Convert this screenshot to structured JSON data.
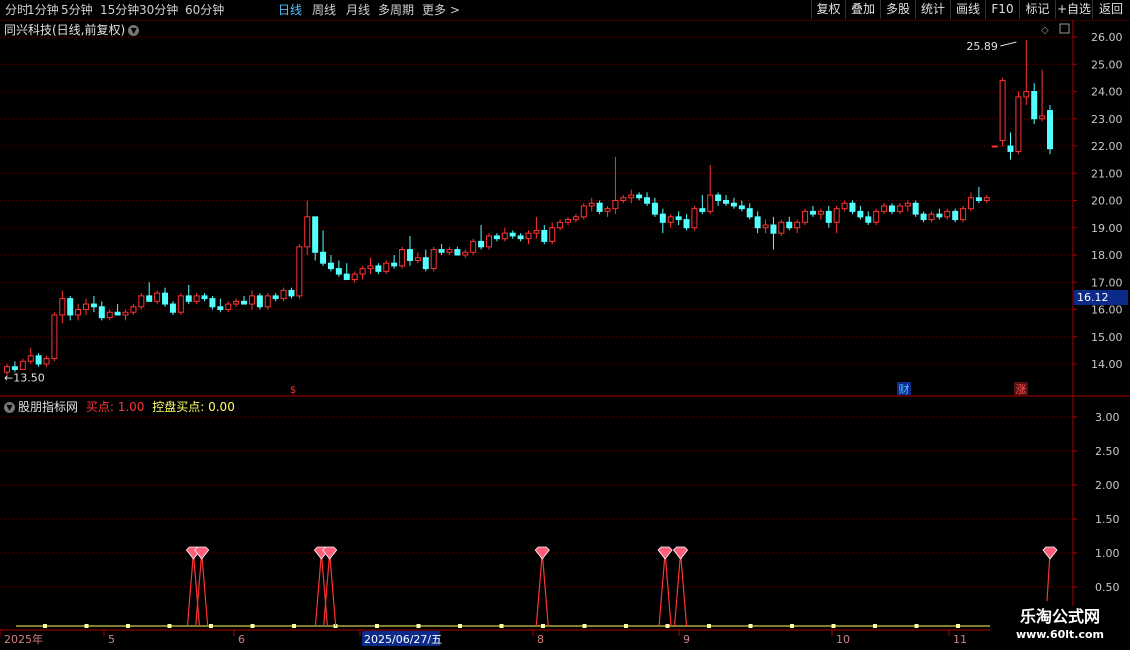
{
  "toolbar": {
    "periods": [
      {
        "label": "分时",
        "active": false
      },
      {
        "label": "1分钟",
        "active": false
      },
      {
        "label": "5分钟",
        "active": false
      },
      {
        "label": "15分钟",
        "active": false
      },
      {
        "label": "30分钟",
        "active": false
      },
      {
        "label": "60分钟",
        "active": false
      },
      {
        "label": "日线",
        "active": true
      },
      {
        "label": "周线",
        "active": false
      },
      {
        "label": "月线",
        "active": false
      },
      {
        "label": "多周期",
        "active": false
      },
      {
        "label": "更多 >",
        "active": false
      }
    ],
    "right": [
      "复权",
      "叠加",
      "多股",
      "统计",
      "画线",
      "F10",
      "标记",
      "+自选",
      "返回"
    ]
  },
  "main_chart": {
    "title": "同兴科技(日线,前复权)",
    "dropdown_icon": "chevron-down-icon",
    "y_ticks": [
      "26.00",
      "25.00",
      "24.00",
      "23.00",
      "22.00",
      "21.00",
      "20.00",
      "19.00",
      "18.00",
      "17.00",
      "16.00",
      "15.00",
      "14.00"
    ],
    "current_price": "16.12",
    "high_label": "25.89",
    "low_label": "13.50",
    "event_markers": [
      {
        "text": "$",
        "color": "#ff3333"
      },
      {
        "text": "财",
        "color": "#4fc3ff"
      },
      {
        "text": "涨",
        "color": "#ff5555"
      }
    ]
  },
  "indicator": {
    "name": "股朋指标网",
    "items": [
      {
        "label": "买点: 1.00",
        "color": "#ff3333"
      },
      {
        "label": "控盘买点: 0.00",
        "color": "#ffff66"
      }
    ],
    "y_ticks": [
      "3.00",
      "2.50",
      "2.00",
      "1.50",
      "1.00",
      "0.50"
    ]
  },
  "date_axis": {
    "labels": [
      "2025年",
      "5",
      "6",
      "2025/06/27/五",
      "8",
      "9",
      "10",
      "11"
    ]
  },
  "watermark": {
    "line1": "乐淘公式网",
    "line2": "www.60lt.com"
  },
  "colors": {
    "up": "#ff3333",
    "down": "#54ffff",
    "grid": "#6b0000",
    "indicator_line": "#ff3333",
    "baseline": "#ffff66"
  },
  "chart_data": [
    {
      "type": "candlestick",
      "title": "同兴科技(日线,前复权)",
      "ylim": [
        13.5,
        26.3
      ],
      "y_ticks": [
        14,
        15,
        16,
        17,
        18,
        19,
        20,
        21,
        22,
        23,
        24,
        25,
        26
      ],
      "candles": [
        {
          "o": 13.7,
          "h": 14.0,
          "l": 13.5,
          "c": 13.9
        },
        {
          "o": 13.9,
          "h": 14.1,
          "l": 13.7,
          "c": 13.8
        },
        {
          "o": 13.8,
          "h": 14.2,
          "l": 13.8,
          "c": 14.1
        },
        {
          "o": 14.1,
          "h": 14.6,
          "l": 14.0,
          "c": 14.3
        },
        {
          "o": 14.3,
          "h": 14.4,
          "l": 13.9,
          "c": 14.0
        },
        {
          "o": 14.0,
          "h": 14.3,
          "l": 13.9,
          "c": 14.2
        },
        {
          "o": 14.2,
          "h": 15.9,
          "l": 14.1,
          "c": 15.8
        },
        {
          "o": 15.8,
          "h": 16.7,
          "l": 15.5,
          "c": 16.4
        },
        {
          "o": 16.4,
          "h": 16.5,
          "l": 15.6,
          "c": 15.8
        },
        {
          "o": 15.8,
          "h": 16.2,
          "l": 15.6,
          "c": 16.0
        },
        {
          "o": 16.0,
          "h": 16.4,
          "l": 15.8,
          "c": 16.2
        },
        {
          "o": 16.2,
          "h": 16.5,
          "l": 15.9,
          "c": 16.1
        },
        {
          "o": 16.1,
          "h": 16.3,
          "l": 15.6,
          "c": 15.7
        },
        {
          "o": 15.7,
          "h": 16.0,
          "l": 15.6,
          "c": 15.9
        },
        {
          "o": 15.9,
          "h": 16.2,
          "l": 15.8,
          "c": 15.8
        },
        {
          "o": 15.8,
          "h": 16.0,
          "l": 15.6,
          "c": 15.9
        },
        {
          "o": 15.9,
          "h": 16.2,
          "l": 15.8,
          "c": 16.1
        },
        {
          "o": 16.1,
          "h": 16.6,
          "l": 16.0,
          "c": 16.5
        },
        {
          "o": 16.5,
          "h": 17.0,
          "l": 16.3,
          "c": 16.3
        },
        {
          "o": 16.3,
          "h": 16.7,
          "l": 16.2,
          "c": 16.6
        },
        {
          "o": 16.6,
          "h": 16.8,
          "l": 16.1,
          "c": 16.2
        },
        {
          "o": 16.2,
          "h": 16.3,
          "l": 15.8,
          "c": 15.9
        },
        {
          "o": 15.9,
          "h": 16.6,
          "l": 15.8,
          "c": 16.5
        },
        {
          "o": 16.5,
          "h": 16.9,
          "l": 16.2,
          "c": 16.3
        },
        {
          "o": 16.3,
          "h": 16.6,
          "l": 16.2,
          "c": 16.5
        },
        {
          "o": 16.5,
          "h": 16.6,
          "l": 16.3,
          "c": 16.4
        },
        {
          "o": 16.4,
          "h": 16.5,
          "l": 16.0,
          "c": 16.1
        },
        {
          "o": 16.1,
          "h": 16.4,
          "l": 15.9,
          "c": 16.0
        },
        {
          "o": 16.0,
          "h": 16.3,
          "l": 15.9,
          "c": 16.2
        },
        {
          "o": 16.2,
          "h": 16.4,
          "l": 16.1,
          "c": 16.3
        },
        {
          "o": 16.3,
          "h": 16.5,
          "l": 16.2,
          "c": 16.2
        },
        {
          "o": 16.2,
          "h": 16.7,
          "l": 16.0,
          "c": 16.5
        },
        {
          "o": 16.5,
          "h": 16.6,
          "l": 16.0,
          "c": 16.1
        },
        {
          "o": 16.1,
          "h": 16.6,
          "l": 16.0,
          "c": 16.5
        },
        {
          "o": 16.5,
          "h": 16.6,
          "l": 16.3,
          "c": 16.4
        },
        {
          "o": 16.4,
          "h": 16.8,
          "l": 16.3,
          "c": 16.7
        },
        {
          "o": 16.7,
          "h": 16.8,
          "l": 16.4,
          "c": 16.5
        },
        {
          "o": 16.5,
          "h": 18.4,
          "l": 16.4,
          "c": 18.3
        },
        {
          "o": 18.3,
          "h": 20.0,
          "l": 18.0,
          "c": 19.4
        },
        {
          "o": 19.4,
          "h": 18.8,
          "l": 17.8,
          "c": 18.1
        },
        {
          "o": 18.1,
          "h": 18.9,
          "l": 17.6,
          "c": 17.7
        },
        {
          "o": 17.7,
          "h": 18.0,
          "l": 17.4,
          "c": 17.5
        },
        {
          "o": 17.5,
          "h": 17.8,
          "l": 17.2,
          "c": 17.3
        },
        {
          "o": 17.3,
          "h": 17.7,
          "l": 17.1,
          "c": 17.1
        },
        {
          "o": 17.1,
          "h": 17.4,
          "l": 17.0,
          "c": 17.3
        },
        {
          "o": 17.3,
          "h": 17.6,
          "l": 17.1,
          "c": 17.5
        },
        {
          "o": 17.5,
          "h": 17.9,
          "l": 17.3,
          "c": 17.6
        },
        {
          "o": 17.6,
          "h": 17.7,
          "l": 17.3,
          "c": 17.4
        },
        {
          "o": 17.4,
          "h": 17.8,
          "l": 17.3,
          "c": 17.7
        },
        {
          "o": 17.7,
          "h": 18.0,
          "l": 17.5,
          "c": 17.6
        },
        {
          "o": 17.6,
          "h": 18.3,
          "l": 17.5,
          "c": 18.2
        },
        {
          "o": 18.2,
          "h": 18.7,
          "l": 17.6,
          "c": 17.8
        },
        {
          "o": 17.8,
          "h": 18.1,
          "l": 17.7,
          "c": 17.9
        },
        {
          "o": 17.9,
          "h": 18.2,
          "l": 17.4,
          "c": 17.5
        },
        {
          "o": 17.5,
          "h": 18.3,
          "l": 17.4,
          "c": 18.2
        },
        {
          "o": 18.2,
          "h": 18.4,
          "l": 18.0,
          "c": 18.1
        },
        {
          "o": 18.1,
          "h": 18.3,
          "l": 18.0,
          "c": 18.2
        },
        {
          "o": 18.2,
          "h": 18.3,
          "l": 18.0,
          "c": 18.0
        },
        {
          "o": 18.0,
          "h": 18.2,
          "l": 17.9,
          "c": 18.1
        },
        {
          "o": 18.1,
          "h": 18.6,
          "l": 18.0,
          "c": 18.5
        },
        {
          "o": 18.5,
          "h": 19.1,
          "l": 18.2,
          "c": 18.3
        },
        {
          "o": 18.3,
          "h": 18.8,
          "l": 18.2,
          "c": 18.7
        },
        {
          "o": 18.7,
          "h": 18.8,
          "l": 18.5,
          "c": 18.6
        },
        {
          "o": 18.6,
          "h": 19.0,
          "l": 18.5,
          "c": 18.8
        },
        {
          "o": 18.8,
          "h": 18.9,
          "l": 18.6,
          "c": 18.7
        },
        {
          "o": 18.7,
          "h": 18.8,
          "l": 18.5,
          "c": 18.6
        },
        {
          "o": 18.6,
          "h": 18.9,
          "l": 18.4,
          "c": 18.8
        },
        {
          "o": 18.8,
          "h": 19.4,
          "l": 18.6,
          "c": 18.9
        },
        {
          "o": 18.9,
          "h": 19.1,
          "l": 18.4,
          "c": 18.5
        },
        {
          "o": 18.5,
          "h": 19.2,
          "l": 18.4,
          "c": 19.0
        },
        {
          "o": 19.0,
          "h": 19.3,
          "l": 18.9,
          "c": 19.2
        },
        {
          "o": 19.2,
          "h": 19.4,
          "l": 19.1,
          "c": 19.3
        },
        {
          "o": 19.3,
          "h": 19.5,
          "l": 19.2,
          "c": 19.4
        },
        {
          "o": 19.4,
          "h": 19.9,
          "l": 19.3,
          "c": 19.8
        },
        {
          "o": 19.8,
          "h": 20.1,
          "l": 19.6,
          "c": 19.9
        },
        {
          "o": 19.9,
          "h": 20.0,
          "l": 19.5,
          "c": 19.6
        },
        {
          "o": 19.6,
          "h": 19.8,
          "l": 19.4,
          "c": 19.7
        },
        {
          "o": 19.7,
          "h": 21.6,
          "l": 19.5,
          "c": 20.0
        },
        {
          "o": 20.0,
          "h": 20.2,
          "l": 19.9,
          "c": 20.1
        },
        {
          "o": 20.1,
          "h": 20.4,
          "l": 19.9,
          "c": 20.2
        },
        {
          "o": 20.2,
          "h": 20.3,
          "l": 20.0,
          "c": 20.1
        },
        {
          "o": 20.1,
          "h": 20.3,
          "l": 19.8,
          "c": 19.9
        },
        {
          "o": 19.9,
          "h": 20.1,
          "l": 19.4,
          "c": 19.5
        },
        {
          "o": 19.5,
          "h": 19.7,
          "l": 18.8,
          "c": 19.2
        },
        {
          "o": 19.2,
          "h": 19.5,
          "l": 19.0,
          "c": 19.4
        },
        {
          "o": 19.4,
          "h": 19.6,
          "l": 19.1,
          "c": 19.3
        },
        {
          "o": 19.3,
          "h": 19.5,
          "l": 18.9,
          "c": 19.0
        },
        {
          "o": 19.0,
          "h": 19.8,
          "l": 18.9,
          "c": 19.7
        },
        {
          "o": 19.7,
          "h": 20.2,
          "l": 19.5,
          "c": 19.6
        },
        {
          "o": 19.6,
          "h": 21.3,
          "l": 19.5,
          "c": 20.2
        },
        {
          "o": 20.2,
          "h": 20.3,
          "l": 19.8,
          "c": 20.0
        },
        {
          "o": 20.0,
          "h": 20.2,
          "l": 19.8,
          "c": 19.9
        },
        {
          "o": 19.9,
          "h": 20.1,
          "l": 19.7,
          "c": 19.8
        },
        {
          "o": 19.8,
          "h": 20.0,
          "l": 19.6,
          "c": 19.7
        },
        {
          "o": 19.7,
          "h": 19.9,
          "l": 19.3,
          "c": 19.4
        },
        {
          "o": 19.4,
          "h": 19.6,
          "l": 18.8,
          "c": 19.0
        },
        {
          "o": 19.0,
          "h": 19.3,
          "l": 18.8,
          "c": 19.1
        },
        {
          "o": 19.1,
          "h": 19.4,
          "l": 18.2,
          "c": 18.8
        },
        {
          "o": 18.8,
          "h": 19.3,
          "l": 18.7,
          "c": 19.2
        },
        {
          "o": 19.2,
          "h": 19.4,
          "l": 18.9,
          "c": 19.0
        },
        {
          "o": 19.0,
          "h": 19.3,
          "l": 18.8,
          "c": 19.2
        },
        {
          "o": 19.2,
          "h": 19.7,
          "l": 19.1,
          "c": 19.6
        },
        {
          "o": 19.6,
          "h": 19.8,
          "l": 19.4,
          "c": 19.5
        },
        {
          "o": 19.5,
          "h": 19.7,
          "l": 19.3,
          "c": 19.6
        },
        {
          "o": 19.6,
          "h": 19.8,
          "l": 19.0,
          "c": 19.2
        },
        {
          "o": 19.2,
          "h": 19.8,
          "l": 18.8,
          "c": 19.7
        },
        {
          "o": 19.7,
          "h": 20.0,
          "l": 19.6,
          "c": 19.9
        },
        {
          "o": 19.9,
          "h": 20.0,
          "l": 19.5,
          "c": 19.6
        },
        {
          "o": 19.6,
          "h": 19.8,
          "l": 19.3,
          "c": 19.4
        },
        {
          "o": 19.4,
          "h": 19.6,
          "l": 19.1,
          "c": 19.2
        },
        {
          "o": 19.2,
          "h": 19.7,
          "l": 19.1,
          "c": 19.6
        },
        {
          "o": 19.6,
          "h": 19.9,
          "l": 19.5,
          "c": 19.8
        },
        {
          "o": 19.8,
          "h": 19.9,
          "l": 19.5,
          "c": 19.6
        },
        {
          "o": 19.6,
          "h": 19.9,
          "l": 19.5,
          "c": 19.8
        },
        {
          "o": 19.8,
          "h": 20.0,
          "l": 19.6,
          "c": 19.9
        },
        {
          "o": 19.9,
          "h": 20.0,
          "l": 19.4,
          "c": 19.5
        },
        {
          "o": 19.5,
          "h": 19.6,
          "l": 19.2,
          "c": 19.3
        },
        {
          "o": 19.3,
          "h": 19.6,
          "l": 19.2,
          "c": 19.5
        },
        {
          "o": 19.5,
          "h": 19.7,
          "l": 19.3,
          "c": 19.4
        },
        {
          "o": 19.4,
          "h": 19.7,
          "l": 19.3,
          "c": 19.6
        },
        {
          "o": 19.6,
          "h": 19.7,
          "l": 19.2,
          "c": 19.3
        },
        {
          "o": 19.3,
          "h": 19.8,
          "l": 19.2,
          "c": 19.7
        },
        {
          "o": 19.7,
          "h": 20.3,
          "l": 19.6,
          "c": 20.1
        },
        {
          "o": 20.1,
          "h": 20.5,
          "l": 19.9,
          "c": 20.0
        },
        {
          "o": 20.0,
          "h": 20.2,
          "l": 19.9,
          "c": 20.1
        },
        {
          "o": 22.0,
          "h": 22.0,
          "l": 22.0,
          "c": 22.0
        },
        {
          "o": 22.2,
          "h": 24.5,
          "l": 22.0,
          "c": 24.4
        },
        {
          "o": 22.0,
          "h": 22.5,
          "l": 21.5,
          "c": 21.8
        },
        {
          "o": 21.8,
          "h": 24.0,
          "l": 21.7,
          "c": 23.8
        },
        {
          "o": 23.8,
          "h": 25.89,
          "l": 23.5,
          "c": 24.0
        },
        {
          "o": 24.0,
          "h": 24.3,
          "l": 22.8,
          "c": 23.0
        },
        {
          "o": 23.0,
          "h": 24.8,
          "l": 22.9,
          "c": 23.1
        },
        {
          "o": 23.3,
          "h": 23.5,
          "l": 21.7,
          "c": 21.9
        }
      ]
    },
    {
      "type": "line",
      "title": "股朋指标网",
      "ylim": [
        0,
        3.3
      ],
      "y_ticks": [
        0.5,
        1.0,
        1.5,
        2.0,
        2.5,
        3.0
      ],
      "series": [
        {
          "name": "买点",
          "signal_positions": [
            0.17,
            0.178,
            0.294,
            0.302,
            0.508,
            0.627,
            0.642,
            1.0
          ],
          "value": 1.0
        },
        {
          "name": "控盘买点",
          "value": 0.0
        }
      ]
    }
  ]
}
